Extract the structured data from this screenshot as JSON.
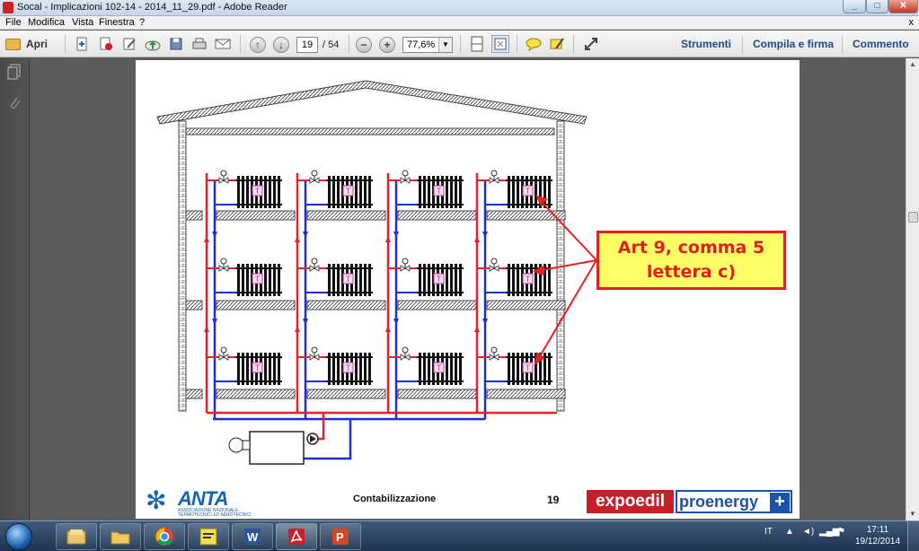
{
  "window": {
    "title": "Socal - Implicazioni 102-14 - 2014_11_29.pdf - Adobe Reader",
    "menu": [
      "File",
      "Modifica",
      "Vista",
      "Finestra",
      "?"
    ],
    "close_glyph": "x"
  },
  "toolbar": {
    "open_label": "Apri",
    "page_current": "19",
    "page_total": "/ 54",
    "zoom": "77,6%",
    "links": [
      "Strumenti",
      "Compila e firma",
      "Commento"
    ]
  },
  "slide": {
    "callout_line1": "Art 9, comma 5",
    "callout_line2": "lettera c)",
    "footer_title": "Contabilizzazione",
    "footer_page": "19",
    "logo_anta": "ANTA",
    "logo_anta_sub": "ASSOCIAZIONE NAZIONALE TERMOTECNICI ED AEROTECNICI",
    "logo_expoedil": "expoedil",
    "logo_proenergy": "proenergy",
    "logo_proenergy_plus": "+",
    "radiator_badge": "T",
    "colors": {
      "supply": "#e8202a",
      "return": "#1a2fd8",
      "callout_bg": "#ffff66",
      "callout_border": "#e62020"
    }
  },
  "taskbar": {
    "apps": [
      "explorer-icon",
      "folder-icon",
      "chrome-icon",
      "postit-icon",
      "word-icon",
      "adobe-reader-icon",
      "powerpoint-icon"
    ],
    "language": "IT",
    "time": "17:11",
    "date": "19/12/2014"
  }
}
